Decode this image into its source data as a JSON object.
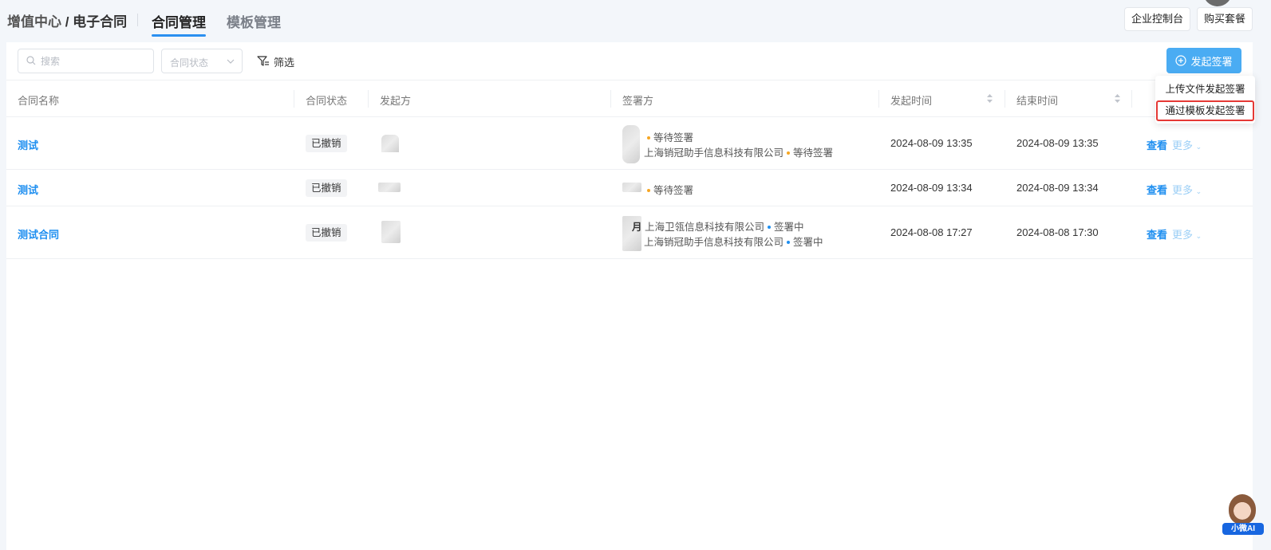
{
  "header": {
    "breadcrumb_parent": "增值中心",
    "breadcrumb_sep": " / ",
    "breadcrumb_current": "电子合同",
    "tabs": [
      {
        "label": "合同管理",
        "active": true
      },
      {
        "label": "模板管理",
        "active": false
      }
    ],
    "console_button": "企业控制台",
    "buy_button": "购买套餐"
  },
  "toolbar": {
    "search_placeholder": "搜索",
    "status_select_placeholder": "合同状态",
    "filter_label": "筛选",
    "launch_button": "发起签署"
  },
  "launch_menu": {
    "items": [
      {
        "label": "上传文件发起签署",
        "highlighted": false
      },
      {
        "label": "通过模板发起签署",
        "highlighted": true
      }
    ]
  },
  "table": {
    "columns": [
      "合同名称",
      "合同状态",
      "发起方",
      "签署方",
      "发起时间",
      "结束时间"
    ],
    "rows": [
      {
        "name": "测试",
        "status": "已撤销",
        "signers": [
          {
            "company": "",
            "state": "等待签署"
          },
          {
            "company": "上海销冠助手信息科技有限公司",
            "state": "等待签署"
          }
        ],
        "start_time": "2024-08-09 13:35",
        "end_time": "2024-08-09 13:35",
        "view": "查看",
        "more": "更多"
      },
      {
        "name": "测试",
        "status": "已撤销",
        "signers": [
          {
            "company": "",
            "state": "等待签署"
          }
        ],
        "start_time": "2024-08-09 13:34",
        "end_time": "2024-08-09 13:34",
        "view": "查看",
        "more": "更多"
      },
      {
        "name": "测试合同",
        "status": "已撤销",
        "signers": [
          {
            "company": "上海卫瓴信息科技有限公司",
            "state": "签署中",
            "prefix": "月"
          },
          {
            "company": "上海销冠助手信息科技有限公司",
            "state": "签署中"
          }
        ],
        "start_time": "2024-08-08 17:27",
        "end_time": "2024-08-08 17:30",
        "view": "查看",
        "more": "更多"
      }
    ]
  },
  "assistant": {
    "label": "小微AI"
  },
  "colors": {
    "accent": "#1f8ff0",
    "launch_bg": "#4aacf3",
    "waiting_dot": "#f5a623",
    "signing_dot": "#1f8ff0",
    "highlight_border": "#e53935"
  }
}
